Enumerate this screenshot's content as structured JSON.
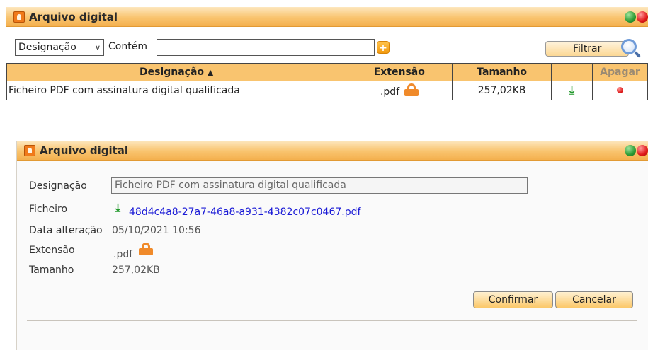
{
  "window": {
    "title": "Arquivo digital"
  },
  "filter": {
    "field_selected": "Designação",
    "operator_label": "Contém",
    "query_value": "",
    "add_label": "+",
    "filter_button": "Filtrar"
  },
  "table": {
    "headers": {
      "designacao": "Designação",
      "extensao": "Extensão",
      "tamanho": "Tamanho",
      "download": "",
      "apagar": "Apagar"
    },
    "sort_indicator": "▲",
    "rows": [
      {
        "designacao": "Ficheiro PDF com assinatura digital qualificada",
        "extensao": ".pdf",
        "tamanho": "257,02KB"
      }
    ]
  },
  "detail": {
    "title": "Arquivo digital",
    "labels": {
      "designacao": "Designação",
      "ficheiro": "Ficheiro",
      "data_alteracao": "Data alteração",
      "extensao": "Extensão",
      "tamanho": "Tamanho"
    },
    "values": {
      "designacao": "Ficheiro PDF com assinatura digital qualificada",
      "ficheiro": "48d4c4a8-27a7-46a8-a931-4382c07c0467.pdf",
      "data_alteracao": "05/10/2021 10:56",
      "extensao": ".pdf",
      "tamanho": "257,02KB"
    },
    "buttons": {
      "confirm": "Confirmar",
      "cancel": "Cancelar"
    }
  },
  "icons": {
    "app": "document-icon",
    "window_controls": [
      "green-dot-icon",
      "red-dot-icon"
    ],
    "lock": "lock-icon",
    "download": "download-icon",
    "delete": "delete-dot-icon",
    "search": "magnifier-icon"
  },
  "colors": {
    "header_orange": "#f9c46f",
    "lock_orange": "#f08a2a",
    "download_green": "#20982a",
    "delete_red": "#d81212",
    "link_blue": "#1a1ad6"
  }
}
